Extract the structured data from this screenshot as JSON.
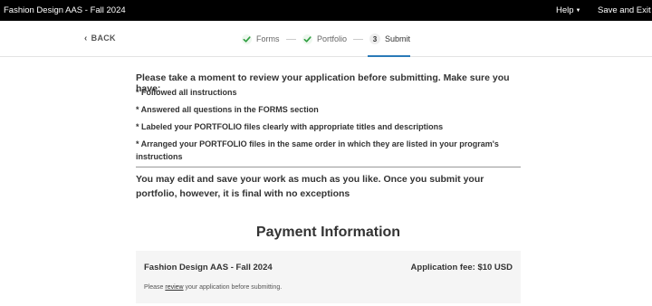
{
  "topbar": {
    "title": "Fashion Design AAS - Fall 2024",
    "help_label": "Help",
    "save_exit_label": "Save and Exit"
  },
  "nav": {
    "back_label": "BACK",
    "steps": [
      {
        "label": "Forms",
        "status": "complete"
      },
      {
        "label": "Portfolio",
        "status": "complete"
      },
      {
        "number": "3",
        "label": "Submit",
        "status": "active"
      }
    ]
  },
  "review": {
    "intro": "Please take a moment to review your application before submitting. Make sure you have:",
    "bullets": [
      "* Followed all instructions",
      "* Answered all questions in the FORMS section",
      "* Labeled your PORTFOLIO files clearly with appropriate titles and descriptions",
      "* Arranged your PORTFOLIO files in the same order in which they are listed in your program's instructions"
    ],
    "edit_note": "You may edit and save your work as much as you like. Once you submit your portfolio, however, it is final with no exceptions"
  },
  "payment": {
    "heading": "Payment Information",
    "program": "Fashion Design AAS - Fall 2024",
    "fee": "Application fee: $10 USD",
    "note_prefix": "Please ",
    "note_link": "review",
    "note_suffix": " your application before submitting."
  },
  "colors": {
    "topbar_bg": "#000000",
    "check_green": "#2e9e3f",
    "active_underline": "#2a7ab8",
    "payment_box_bg": "#f5f5f5"
  }
}
